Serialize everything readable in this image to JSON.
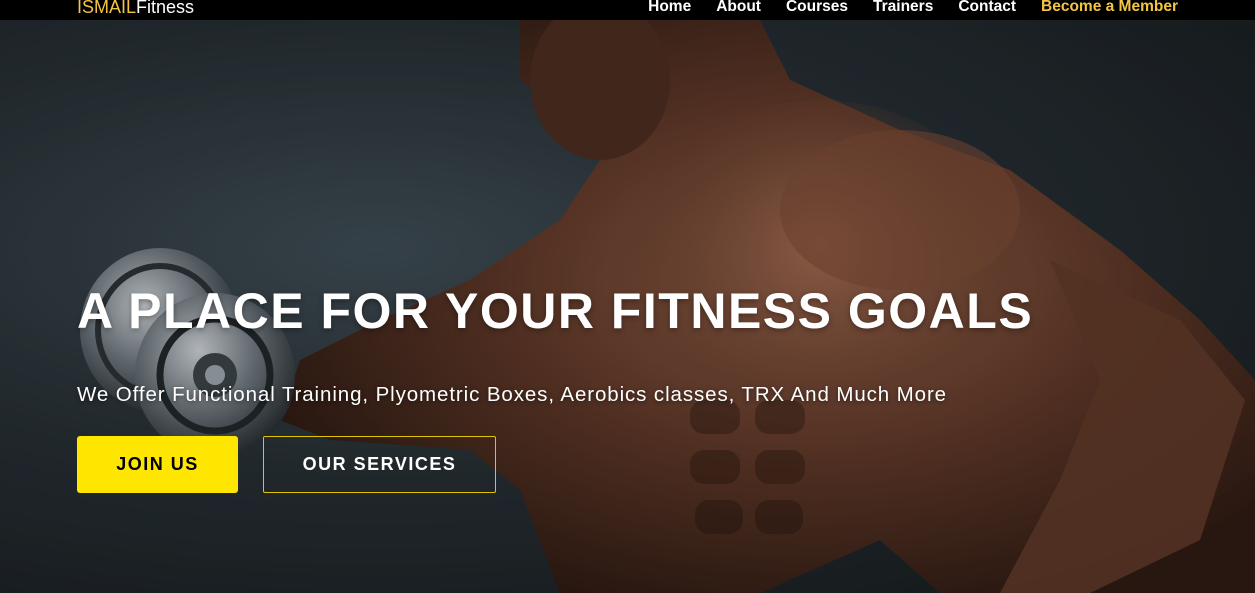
{
  "brand": {
    "part1": "ISMAIL",
    "part2": "Fitness"
  },
  "nav": {
    "items": [
      {
        "label": "Home"
      },
      {
        "label": "About"
      },
      {
        "label": "Courses"
      },
      {
        "label": "Trainers"
      },
      {
        "label": "Contact"
      }
    ],
    "cta_label": "Become a Member"
  },
  "hero": {
    "title": "A PLACE FOR YOUR FITNESS GOALS",
    "subtitle": "We Offer Functional Training, Plyometric Boxes, Aerobics classes, TRX And Much More",
    "primary_button": "JOIN US",
    "secondary_button": "OUR SERVICES"
  },
  "colors": {
    "accent": "#f4c542",
    "button_yellow": "#ffe600",
    "navbar": "#000000",
    "hero_bg": "#262e33"
  }
}
